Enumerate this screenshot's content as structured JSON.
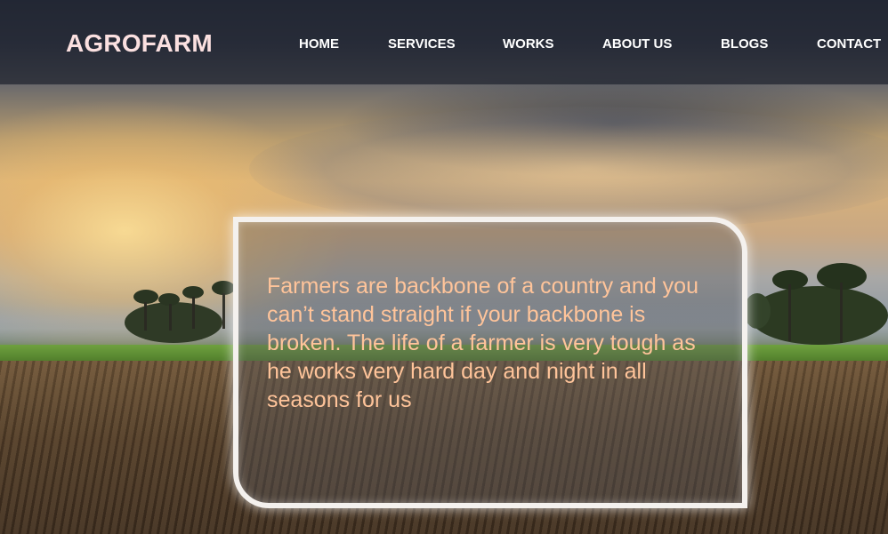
{
  "header": {
    "logo": "AGROFARM",
    "nav": [
      {
        "label": "HOME"
      },
      {
        "label": "SERVICES"
      },
      {
        "label": "WORKS"
      },
      {
        "label": "ABOUT US"
      },
      {
        "label": "BLOGS"
      },
      {
        "label": "CONTACT"
      }
    ]
  },
  "hero": {
    "quote": "Farmers are backbone of a country and you can’t stand straight if your backbone is broken. The life of a farmer is very tough as he works very hard day and night in all seasons for us"
  },
  "colors": {
    "header_bg": "#1e222e",
    "logo": "#fbe0e0",
    "nav_text": "#ffffff",
    "quote_text": "#ffc49a",
    "box_border": "#f4f1ee"
  }
}
